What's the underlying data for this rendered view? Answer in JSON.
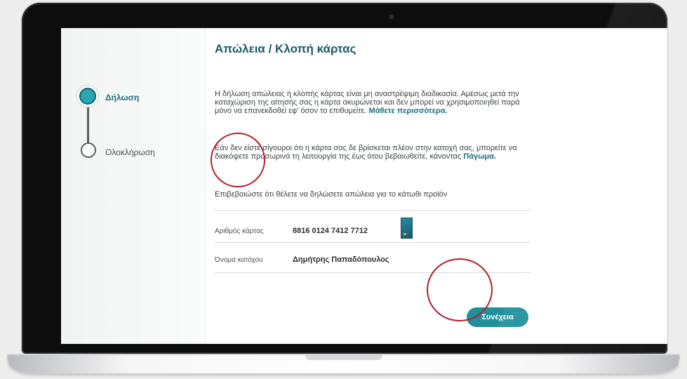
{
  "page_title": "Απώλεια / Κλοπή κάρτας",
  "steps": [
    {
      "label": "Δήλωση",
      "active": true
    },
    {
      "label": "Ολοκλήρωση",
      "active": false
    }
  ],
  "paragraph1": {
    "text": "Η δήλωση απώλειας ή κλοπής κάρτας είναι μη αναστρέψιμη διαδικασία. Αμέσως μετά την καταχώριση της αίτησής σας η κάρτα ακυρώνεται και δεν μπορεί να χρησιμοποιηθεί παρά μόνο να επανεκδοθεί εφ' όσον το επιθυμείτε.",
    "link": "Μάθετε περισσότερα."
  },
  "paragraph2": {
    "text": "Εάν δεν είστε σίγουροι ότι η κάρτα σας δε βρίσκεται πλέον στην κατοχή σας, μπορείτε να διακόψετε προσωρινά τη λειτουργία της έως ότου βεβαιωθείτε, κάνοντας",
    "link": "Πάγωμα."
  },
  "paragraph3": "Επιβεβαιώστε ότι θέλετε να δηλώσετε απώλεια για το κάτωθι προϊόν",
  "card_details": {
    "number_label": "Αριθμός κάρτας",
    "number_value": "8816 0124 7412 7712",
    "holder_label": "Όνομα κατόχου",
    "holder_value": "Δημήτρης Παπαδόπουλος"
  },
  "continue_button": "Συνέχεια",
  "colors": {
    "accent": "#1f8f9a",
    "title": "#1f5a66",
    "highlight_ring": "#b21e2b"
  }
}
